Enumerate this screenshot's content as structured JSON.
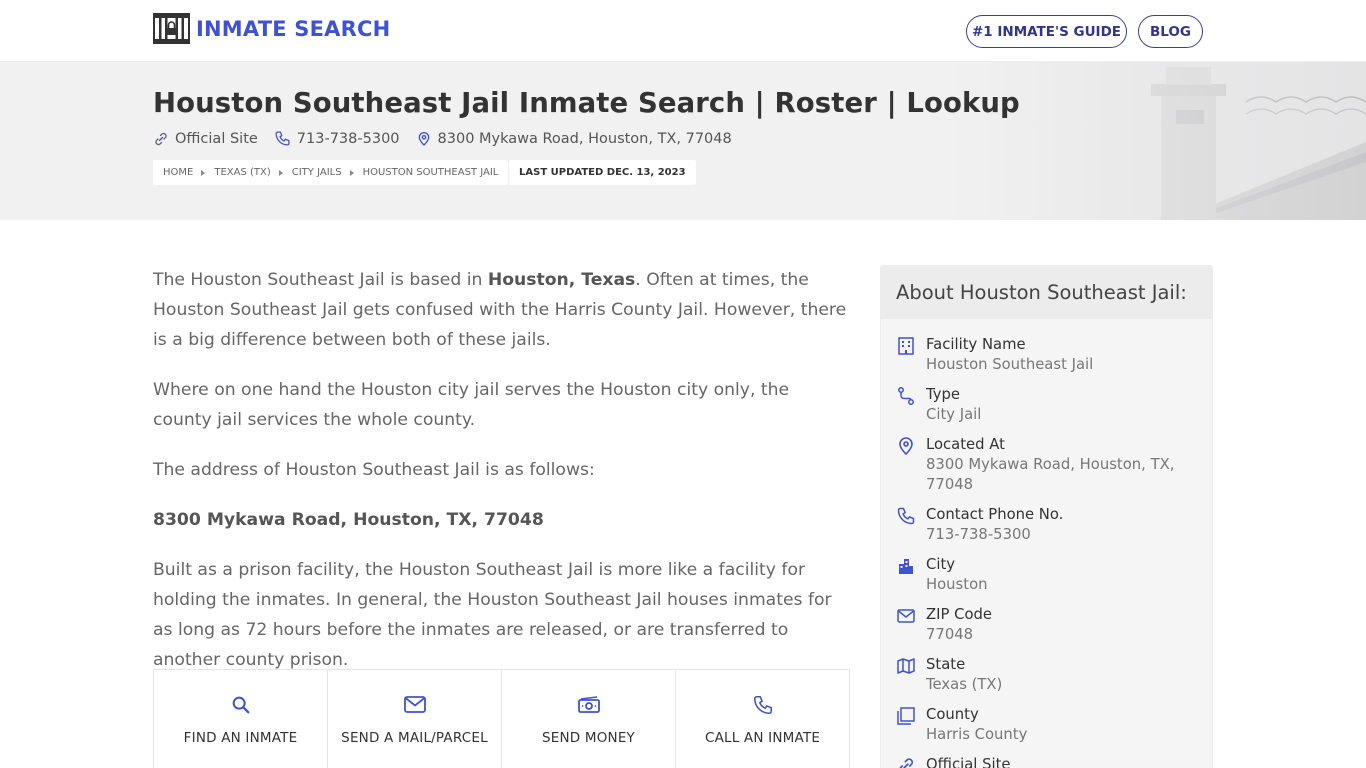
{
  "header": {
    "logo_text": "INMATE SEARCH",
    "nav": [
      {
        "label": "#1 INMATE'S GUIDE"
      },
      {
        "label": "BLOG"
      }
    ]
  },
  "hero": {
    "title": "Houston Southeast Jail Inmate Search | Roster | Lookup",
    "official_site_label": "Official Site",
    "phone": "713-738-5300",
    "address": "8300 Mykawa Road, Houston, TX, 77048",
    "breadcrumbs": [
      "HOME",
      "TEXAS (TX)",
      "CITY JAILS",
      "HOUSTON SOUTHEAST JAIL"
    ],
    "last_updated": "LAST UPDATED DEC. 13, 2023"
  },
  "article": {
    "p1_before": "The Houston Southeast Jail is based in ",
    "p1_bold": "Houston, Texas",
    "p1_after": ". Often at times, the Houston Southeast Jail gets confused with the Harris County Jail. However, there is a big difference between both of these jails.",
    "p2": "Where on one hand the Houston city jail serves the Houston city only, the county jail services the whole county.",
    "p3": "The address of Houston Southeast Jail is as follows:",
    "address_line": "8300 Mykawa Road, Houston, TX, 77048",
    "p4": "Built as a prison facility, the Houston Southeast Jail is more like a facility for holding the inmates. In general, the Houston Southeast Jail houses inmates for as long as 72 hours before the inmates are released, or are transferred to another county prison."
  },
  "actions": [
    {
      "label": "FIND AN INMATE",
      "icon": "search-icon"
    },
    {
      "label": "SEND A MAIL/PARCEL",
      "icon": "mail-icon"
    },
    {
      "label": "SEND MONEY",
      "icon": "money-icon"
    },
    {
      "label": "CALL AN INMATE",
      "icon": "phone-icon"
    }
  ],
  "sidebar": {
    "title": "About Houston Southeast Jail:",
    "items": [
      {
        "label": "Facility Name",
        "value": "Houston Southeast Jail",
        "icon": "building-icon"
      },
      {
        "label": "Type",
        "value": "City Jail",
        "icon": "route-icon"
      },
      {
        "label": "Located At",
        "value": "8300 Mykawa Road, Houston, TX, 77048",
        "icon": "location-pin-icon"
      },
      {
        "label": "Contact Phone No.",
        "value": "713-738-5300",
        "icon": "phone-icon"
      },
      {
        "label": "City",
        "value": "Houston",
        "icon": "city-icon"
      },
      {
        "label": "ZIP Code",
        "value": "77048",
        "icon": "mail-icon"
      },
      {
        "label": "State",
        "value": "Texas (TX)",
        "icon": "map-icon"
      },
      {
        "label": "County",
        "value": "Harris County",
        "icon": "copy-icon"
      },
      {
        "label": "Official Site",
        "value": "",
        "icon": "link-icon"
      }
    ]
  },
  "colors": {
    "brand_blue": "#3e52d3",
    "nav_border": "#3b3f9a",
    "hero_bg": "#f1f1f2",
    "sidebar_bg": "#f5f5f5"
  }
}
